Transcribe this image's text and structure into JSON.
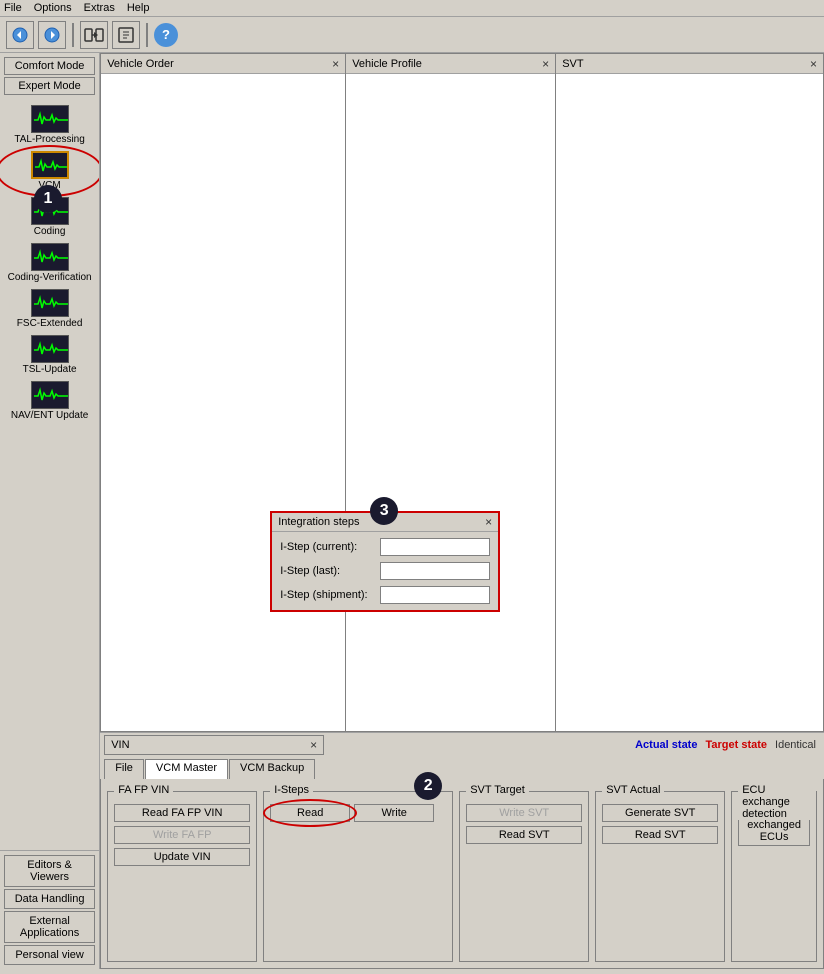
{
  "menubar": {
    "items": [
      "File",
      "Options",
      "Extras",
      "Help"
    ]
  },
  "toolbar": {
    "buttons": [
      {
        "name": "back-button",
        "icon": "◀",
        "label": "Back"
      },
      {
        "name": "forward-button",
        "icon": "▶",
        "label": "Forward"
      },
      {
        "name": "connect-button",
        "icon": "⇄",
        "label": "Connect"
      },
      {
        "name": "export-button",
        "icon": "📄",
        "label": "Export"
      },
      {
        "name": "help-button",
        "icon": "?",
        "label": "Help"
      }
    ]
  },
  "sidebar": {
    "mode_buttons": [
      {
        "label": "Comfort Mode",
        "name": "comfort-mode-button"
      },
      {
        "label": "Expert Mode",
        "name": "expert-mode-button"
      }
    ],
    "items": [
      {
        "label": "TAL-Processing",
        "name": "tal-processing-item"
      },
      {
        "label": "VCM",
        "name": "vcm-item",
        "highlighted": true
      },
      {
        "label": "Coding",
        "name": "coding-item"
      },
      {
        "label": "Coding-Verification",
        "name": "coding-verification-item"
      },
      {
        "label": "FSC-Extended",
        "name": "fsc-extended-item"
      },
      {
        "label": "TSL-Update",
        "name": "tsl-update-item"
      },
      {
        "label": "NAV/ENT Update",
        "name": "nav-ent-update-item"
      }
    ],
    "bottom_buttons": [
      {
        "label": "Editors & Viewers",
        "name": "editors-viewers-button"
      },
      {
        "label": "Data Handling",
        "name": "data-handling-button"
      },
      {
        "label": "External Applications",
        "name": "external-applications-button"
      },
      {
        "label": "Personal view",
        "name": "personal-view-button"
      }
    ]
  },
  "panels": {
    "vehicle_order": {
      "title": "Vehicle Order"
    },
    "vehicle_profile": {
      "title": "Vehicle Profile"
    },
    "svt": {
      "title": "SVT"
    }
  },
  "integration_steps": {
    "title": "Integration steps",
    "fields": [
      {
        "label": "I-Step (current):",
        "value": ""
      },
      {
        "label": "I-Step (last):",
        "value": ""
      },
      {
        "label": "I-Step (shipment):",
        "value": ""
      }
    ]
  },
  "vin_panel": {
    "title": "VIN"
  },
  "state_labels": {
    "actual": "Actual state",
    "target": "Target state",
    "identical": "Identical"
  },
  "tabs": [
    {
      "label": "File",
      "name": "tab-file"
    },
    {
      "label": "VCM Master",
      "name": "tab-vcm-master",
      "active": true
    },
    {
      "label": "VCM Backup",
      "name": "tab-vcm-backup"
    }
  ],
  "sections": {
    "fa_fp_vin": {
      "title": "FA FP VIN",
      "buttons": [
        {
          "label": "Read FA FP VIN",
          "name": "read-fa-fp-vin-button",
          "disabled": false
        },
        {
          "label": "Write FA FP",
          "name": "write-fa-fp-button",
          "disabled": true
        },
        {
          "label": "Update VIN",
          "name": "update-vin-button",
          "disabled": false
        }
      ]
    },
    "isteps": {
      "title": "I-Steps",
      "buttons": [
        {
          "label": "Read",
          "name": "read-button",
          "disabled": false,
          "highlighted": true
        },
        {
          "label": "Write",
          "name": "write-button",
          "disabled": false
        }
      ]
    },
    "svt_target": {
      "title": "SVT Target",
      "buttons": [
        {
          "label": "Write SVT",
          "name": "write-svt-button",
          "disabled": true
        },
        {
          "label": "Read SVT",
          "name": "read-svt-target-button",
          "disabled": false
        }
      ]
    },
    "svt_actual": {
      "title": "SVT Actual",
      "buttons": [
        {
          "label": "Generate SVT",
          "name": "generate-svt-button",
          "disabled": false
        },
        {
          "label": "Read SVT",
          "name": "read-svt-actual-button",
          "disabled": false
        }
      ]
    },
    "ecu_exchange": {
      "title": "ECU exchange detection",
      "buttons": [
        {
          "label": "Detect exchanged ECUs",
          "name": "detect-exchanged-ecus-button",
          "disabled": false
        }
      ]
    }
  },
  "badges": {
    "badge1": "1",
    "badge2": "2",
    "badge3": "3"
  }
}
